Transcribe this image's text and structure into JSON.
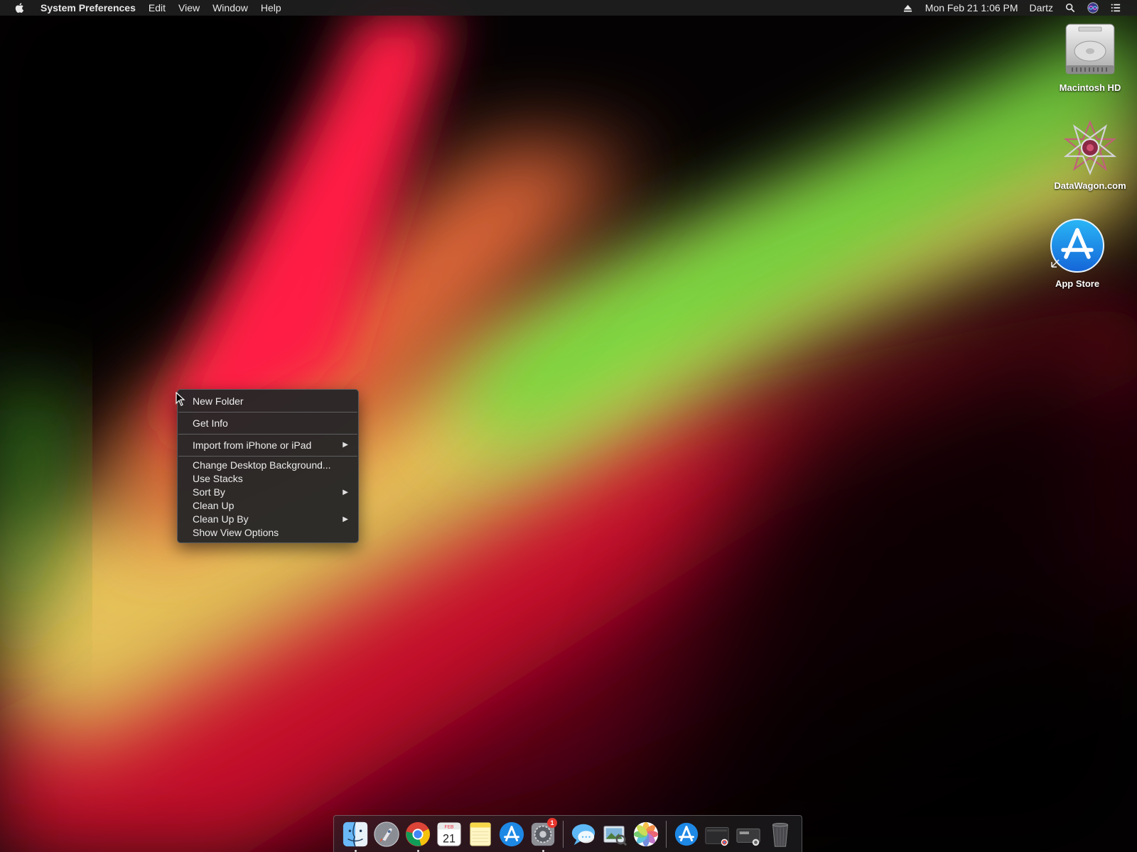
{
  "menubar": {
    "app_name": "System Preferences",
    "menus": [
      "Edit",
      "View",
      "Window",
      "Help"
    ],
    "datetime": "Mon Feb 21  1:06 PM",
    "user": "Dartz"
  },
  "desktop_icons": [
    {
      "label": "Macintosh HD",
      "icon": "hard-drive-icon"
    },
    {
      "label": "DataWagon.com",
      "icon": "datawagon-icon"
    },
    {
      "label": "App Store",
      "icon": "app-store-icon"
    }
  ],
  "context_menu": {
    "new_folder": "New Folder",
    "get_info": "Get Info",
    "import": "Import from iPhone or iPad",
    "change_bg": "Change Desktop Background...",
    "use_stacks": "Use Stacks",
    "sort_by": "Sort By",
    "clean_up": "Clean Up",
    "clean_up_by": "Clean Up By",
    "show_view_options": "Show View Options"
  },
  "dock": {
    "apps": [
      "finder-icon",
      "launchpad-icon",
      "chrome-icon",
      "calendar-icon",
      "notes-icon",
      "app-store-icon",
      "system-preferences-icon",
      "messages-icon",
      "preview-icon",
      "photos-icon",
      "app-store-download-icon",
      "screenshot-folder-icon",
      "device-folder-icon",
      "trash-icon"
    ],
    "calendar_month": "FEB",
    "calendar_day": "21",
    "sysprefs_badge": "1"
  },
  "colors": {
    "menubar_bg": "#1e1e1e",
    "menu_bg": "#262628",
    "wallpaper_red": "#e8193a",
    "wallpaper_green": "#6edc3c",
    "wallpaper_yellow": "#e6c35a"
  }
}
